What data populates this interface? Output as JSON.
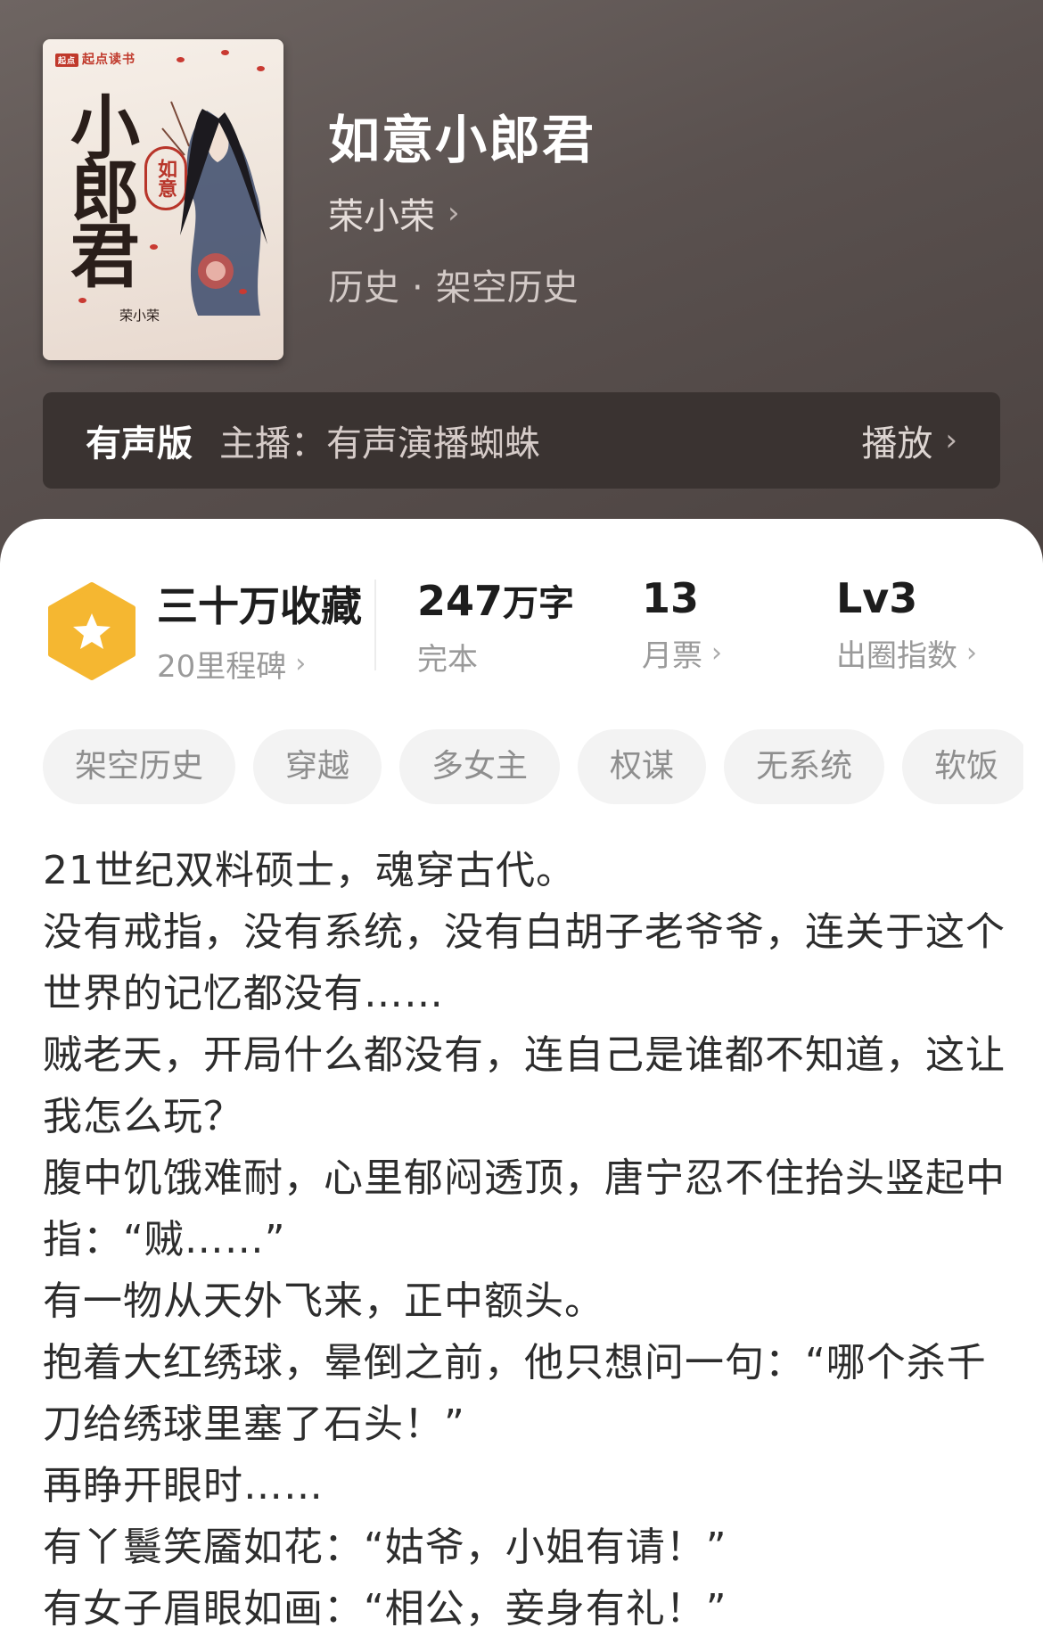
{
  "book": {
    "title": "如意小郎君",
    "author": "荣小荣",
    "genre_main": "历史",
    "genre_dot": "·",
    "genre_sub": "架空历史"
  },
  "cover": {
    "publisher": "起点读书",
    "publisher_logo": "起点",
    "calligraphy": "小郎君",
    "seal": "如意",
    "author_mark": "荣小荣"
  },
  "audio": {
    "tag": "有声版",
    "host": "主播：有声演播蜘蛛",
    "play_label": "播放"
  },
  "stats": {
    "collect": {
      "value": "三十万收藏",
      "sub": "20里程碑"
    },
    "words": {
      "value": "247",
      "unit": "万字",
      "sub": "完本"
    },
    "tickets": {
      "value": "13",
      "sub": "月票"
    },
    "level": {
      "value": "Lv3",
      "sub": "出圈指数"
    }
  },
  "tags": [
    "架空历史",
    "穿越",
    "多女主",
    "权谋",
    "无系统",
    "软饭"
  ],
  "description": [
    "21世纪双料硕士，魂穿古代。",
    "没有戒指，没有系统，没有白胡子老爷爷，连关于这个世界的记忆都没有……",
    "贼老天，开局什么都没有，连自己是谁都不知道，这让我怎么玩？",
    "腹中饥饿难耐，心里郁闷透顶，唐宁忍不住抬头竖起中指：“贼……”",
    "有一物从天外飞来，正中额头。",
    "抱着大红绣球，晕倒之前，他只想问一句：“哪个杀千刀给绣球里塞了石头！”",
    "再睁开眼时……",
    "有丫鬟笑靥如花：“姑爷，小姐有请！”",
    "有女子眉眼如画：“相公，妾身有礼！”"
  ],
  "colors": {
    "header_bg": "#5a514f",
    "badge": "#f5b731",
    "sheet_bg": "#ffffff"
  }
}
